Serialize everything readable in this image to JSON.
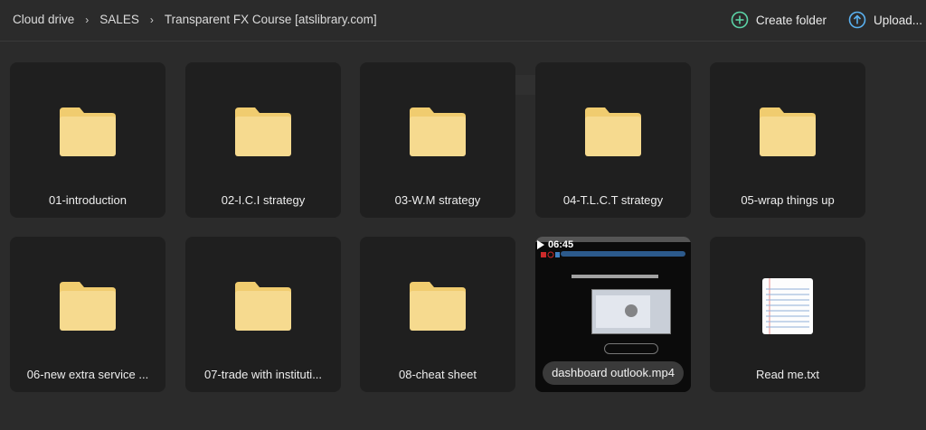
{
  "breadcrumb": {
    "items": [
      "Cloud drive",
      "SALES",
      "Transparent FX Course [atslibrary.com]"
    ],
    "separator": "›"
  },
  "actions": {
    "create_folder": "Create folder",
    "upload": "Upload..."
  },
  "colors": {
    "accent_green": "#5bd3a6",
    "accent_blue": "#5ab1f0",
    "folder_body": "#f6da8f",
    "folder_back": "#f0cc6f"
  },
  "items": [
    {
      "name": "01-introduction",
      "type": "folder",
      "icon": "folder-icon"
    },
    {
      "name": "02-I.C.I strategy",
      "type": "folder",
      "icon": "folder-icon"
    },
    {
      "name": "03-W.M strategy",
      "type": "folder",
      "icon": "folder-icon"
    },
    {
      "name": "04-T.L.C.T strategy",
      "type": "folder",
      "icon": "folder-icon"
    },
    {
      "name": "05-wrap things up",
      "type": "folder",
      "icon": "folder-icon"
    },
    {
      "name": "06-new extra service ...",
      "type": "folder",
      "icon": "folder-icon"
    },
    {
      "name": "07-trade with instituti...",
      "type": "folder",
      "icon": "folder-icon"
    },
    {
      "name": "08-cheat sheet",
      "type": "folder",
      "icon": "folder-icon"
    },
    {
      "name": "dashboard outlook.mp4",
      "type": "video",
      "icon": "video-thumbnail",
      "duration": "06:45"
    },
    {
      "name": "Read me.txt",
      "type": "text",
      "icon": "text-file-icon"
    }
  ]
}
